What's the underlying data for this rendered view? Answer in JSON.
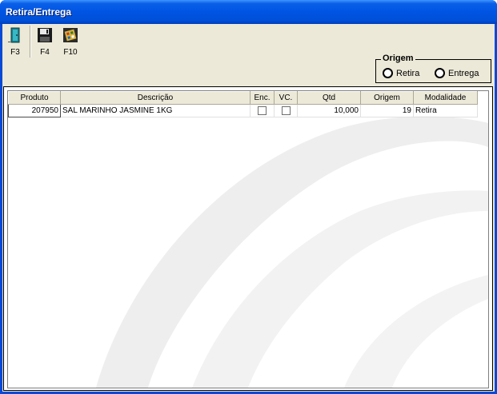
{
  "window": {
    "title": "Retira/Entrega"
  },
  "toolbar": {
    "buttons": [
      {
        "key": "F3",
        "icon": "exit-door-icon"
      },
      {
        "key": "F4",
        "icon": "floppy-disk-icon"
      },
      {
        "key": "F10",
        "icon": "calculator-icon"
      }
    ]
  },
  "origem": {
    "legend": "Origem",
    "options": [
      {
        "label": "Retira",
        "selected": false
      },
      {
        "label": "Entrega",
        "selected": false
      }
    ]
  },
  "grid": {
    "columns": [
      "Produto",
      "Descrição",
      "Enc.",
      "VC.",
      "Qtd",
      "Origem",
      "Modalidade"
    ],
    "rows": [
      {
        "produto": "207950",
        "descricao": "SAL MARINHO JASMINE 1KG",
        "enc": false,
        "vc": false,
        "qtd": "10,000",
        "origem": "19",
        "modalidade": "Retira"
      }
    ]
  }
}
